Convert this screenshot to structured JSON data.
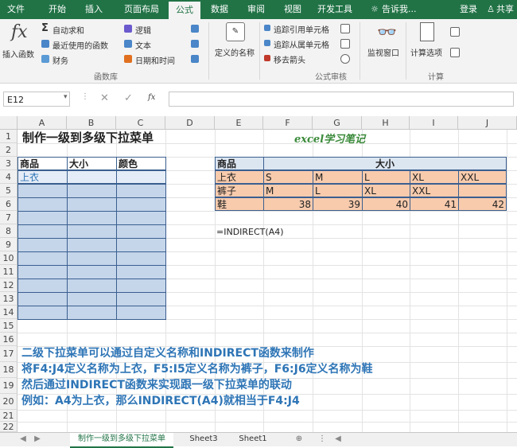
{
  "ribbon_tabs": [
    "文件",
    "开始",
    "插入",
    "页面布局",
    "公式",
    "数据",
    "审阅",
    "视图",
    "开发工具"
  ],
  "tell_me": "告诉我...",
  "login": "登录",
  "share": "共享",
  "ribbon": {
    "insert_function": "插入函数",
    "autosum": "自动求和",
    "recent": "最近使用的函数",
    "finance": "财务",
    "logic": "逻辑",
    "text": "文本",
    "datetime": "日期和时间",
    "group_library": "函数库",
    "define_name": "定义的名称",
    "trace_precedents": "追踪引用单元格",
    "trace_dependents": "追踪从属单元格",
    "remove_arrows": "移去箭头",
    "group_audit": "公式审核",
    "watch_window": "监视窗口",
    "calc_options": "计算选项",
    "group_calc": "计算"
  },
  "name_box": "E12",
  "fx_symbol": "fx",
  "columns": [
    "A",
    "B",
    "C",
    "D",
    "E",
    "F",
    "G",
    "H",
    "I",
    "J"
  ],
  "rows": [
    "1",
    "2",
    "3",
    "4",
    "5",
    "6",
    "7",
    "8",
    "9",
    "10",
    "11",
    "12",
    "13",
    "14",
    "15",
    "16",
    "17",
    "18",
    "19",
    "20",
    "21",
    "22"
  ],
  "title": "制作一级到多级下拉菜单",
  "logo": "excel学习笔记",
  "left_table": {
    "h1": "商品",
    "h2": "大小",
    "h3": "颜色",
    "a4": "上衣"
  },
  "right_table": {
    "e3": "商品",
    "size_header": "大小",
    "e4": "上衣",
    "f4": "S",
    "g4": "M",
    "h4": "L",
    "i4": "XL",
    "j4": "XXL",
    "e5": "裤子",
    "f5": "M",
    "g5": "L",
    "h5": "XL",
    "i5": "XXL",
    "e6": "鞋",
    "f6": "38",
    "g6": "39",
    "h6": "40",
    "i6": "41",
    "j6": "42"
  },
  "formula_text": "=INDIRECT(A4)",
  "notes": [
    "二级下拉菜单可以通过自定义名称和INDIRECT函数来制作",
    "将F4:J4定义名称为上衣，F5:I5定义名称为裤子，F6:J6定义名称为鞋",
    "然后通过INDIRECT函数来实现跟一级下拉菜单的联动",
    "例如：A4为上衣，那么INDIRECT(A4)就相当于F4:J4"
  ],
  "sheet_tabs": [
    "制作一级到多级下拉菜单",
    "Sheet3",
    "Sheet1"
  ]
}
